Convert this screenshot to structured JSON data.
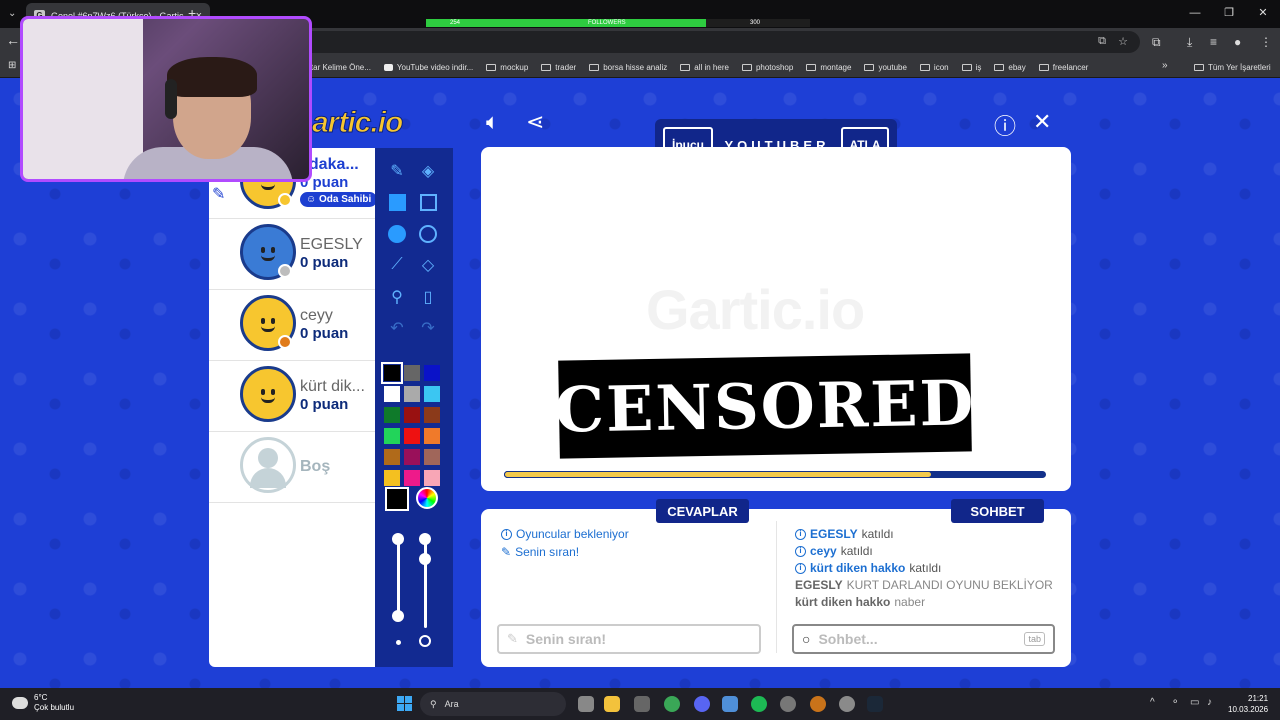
{
  "browser": {
    "tab_title": "Genel #6n7Wz6 (Türkçe) - Gartic",
    "tab_favicon": "G",
    "close_icon": "×",
    "new_tab_icon": "+",
    "followers_left": "254",
    "followers_label": "FOLLOWERS",
    "followers_right": "300",
    "followers_progress": 0.73,
    "bookmarks": [
      {
        "label": "ahtar Kelime Öne...",
        "icon": "none"
      },
      {
        "label": "YouTube video indir...",
        "icon": "youtube"
      },
      {
        "label": "mockup",
        "icon": "folder"
      },
      {
        "label": "trader",
        "icon": "folder"
      },
      {
        "label": "borsa hisse analiz",
        "icon": "folder"
      },
      {
        "label": "all in here",
        "icon": "folder"
      },
      {
        "label": "photoshop",
        "icon": "folder"
      },
      {
        "label": "montage",
        "icon": "folder"
      },
      {
        "label": "youtube",
        "icon": "folder"
      },
      {
        "label": "icon",
        "icon": "folder"
      },
      {
        "label": "iş",
        "icon": "folder"
      },
      {
        "label": "ebay",
        "icon": "folder"
      },
      {
        "label": "freelancer",
        "icon": "folder"
      }
    ],
    "all_bookmarks": "Tüm Yer İşaretleri"
  },
  "game": {
    "logo": "artic.io",
    "word_panel": {
      "hint_button": "İpucu",
      "word": "YOUTUBER",
      "skip_button": "ATLA"
    },
    "players": [
      {
        "name": "adaka...",
        "points": "0 puan",
        "badge": "Oda Sahibi",
        "avatar": "yellow",
        "status_color": "#f7c62f",
        "drawing": true
      },
      {
        "name": "EGESLY",
        "points": "0 puan",
        "avatar": "egesly",
        "status_color": "#bdbdbd"
      },
      {
        "name": "ceyy",
        "points": "0 puan",
        "avatar": "yellow",
        "status_color": "#e07b1a"
      },
      {
        "name": "kürt dik...",
        "points": "0 puan",
        "avatar": "yellow"
      },
      {
        "name": "Boş",
        "avatar": "empty"
      }
    ],
    "palette": [
      "#000000",
      "#666666",
      "#0a12c8",
      "#ffffff",
      "#aaaaaa",
      "#3bc6f2",
      "#0f7a2a",
      "#991111",
      "#8b3a1a",
      "#22d45a",
      "#ee1111",
      "#f07a2a",
      "#b06a1a",
      "#99105a",
      "#a0665a",
      "#f4c020",
      "#ee1a8a",
      "#f8a6b6"
    ],
    "selected_color": "#000000",
    "canvas": {
      "watermark": "Gartic.io",
      "censored_label": "CENSORED",
      "timer_progress": 0.79
    },
    "answers": {
      "label": "CEVAPLAR",
      "messages": [
        {
          "icon": "info-icon",
          "text": "Oyuncular bekleniyor"
        },
        {
          "icon": "pencil-icon",
          "text": "Senin sıran!"
        }
      ],
      "input_placeholder": "Senin sıran!"
    },
    "chat": {
      "label": "SOHBET",
      "messages": [
        {
          "user": "EGESLY",
          "text": "katıldı",
          "type": "system"
        },
        {
          "user": "ceyy",
          "text": "katıldı",
          "type": "system"
        },
        {
          "user": "kürt diken hakko",
          "text": "katıldı",
          "type": "system"
        },
        {
          "user": "EGESLY",
          "text": "KURT DARLANDI OYUNU BEKLİYOR",
          "type": "chat"
        },
        {
          "user": "kürt diken hakko",
          "text": "naber",
          "type": "chat"
        }
      ],
      "input_placeholder": "Sohbet...",
      "tab_hint": "tab"
    }
  },
  "taskbar": {
    "weather_temp": "6°C",
    "weather_desc": "Çok bulutlu",
    "search_label": "Ara",
    "time": "21:21",
    "date": "10.03.2026"
  }
}
